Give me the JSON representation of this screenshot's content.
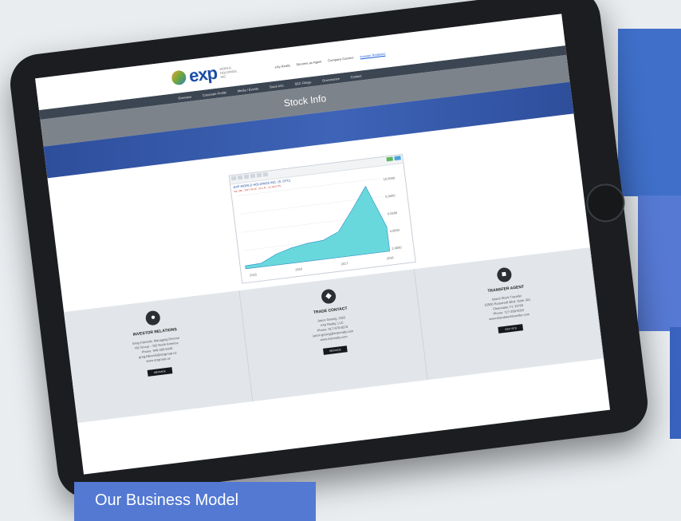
{
  "site": {
    "brand": "exp",
    "brand_sub": "WORLD HOLDINGS, INC.",
    "top_links": [
      "eXp Realty",
      "Become an Agent",
      "Company Careers",
      "Investor Relations"
    ],
    "nav": [
      "Overview",
      "Corporate Profile",
      "Media / Events",
      "Stock Info",
      "SEC Filings",
      "Governance",
      "Contact"
    ],
    "page_title": "Stock Info"
  },
  "chart": {
    "title": "EXP WORLD HOLDINGS INC. (S. OTC)",
    "subtitle": "Vol: 28k · 2017-06-16 · 20.1 M · 21.1M (LTS)",
    "yaxis": [
      "10.0000",
      "8.0000",
      "6.0000",
      "4.0000",
      "2.0000"
    ],
    "xaxis": [
      "2015",
      "2016",
      "2017",
      "2018"
    ]
  },
  "chart_data": {
    "type": "area",
    "title": "EXP WORLD HOLDINGS INC. (S. OTC)",
    "x": [
      "2015",
      "2016",
      "2017",
      "2018"
    ],
    "series": [
      {
        "values": [
          0.5,
          0.6,
          1.8,
          2.5,
          2.9,
          3.1,
          4.2,
          7.5,
          11.0,
          4.0
        ]
      }
    ],
    "ylim": [
      0,
      12
    ],
    "grid": true
  },
  "cards": [
    {
      "title": "INVESTOR RELATIONS",
      "lines": [
        "Greg Falesnik, Managing Director",
        "MZ Group – MZ North America",
        "Phone: 949-385-6449",
        "greg.falesnik@mzgroup.us",
        "www.mzgroup.us"
      ],
      "button": "MESSAGE"
    },
    {
      "title": "TRADE CONTACT",
      "lines": [
        "Jason Gesing, CEO",
        "eXp Realty, LLC",
        "Phone: 917-970-8578",
        "jason.gesing@exprealty.com",
        "www.exprealty.com"
      ],
      "button": "MESSAGE"
    },
    {
      "title": "TRANSFER AGENT",
      "lines": [
        "Island Stock Transfer",
        "15500 Roosevelt Blvd, Suite 301",
        "Clearwater, FL 33760",
        "Phone: 727-289-0010",
        "www.islandstocktransfer.com"
      ],
      "button": "VISIT SITE"
    }
  ],
  "caption": "Our Business Model",
  "colors": {
    "accent_blue": "#5379d3",
    "tablet": "#1b1d20",
    "nav": "#3c4653"
  }
}
